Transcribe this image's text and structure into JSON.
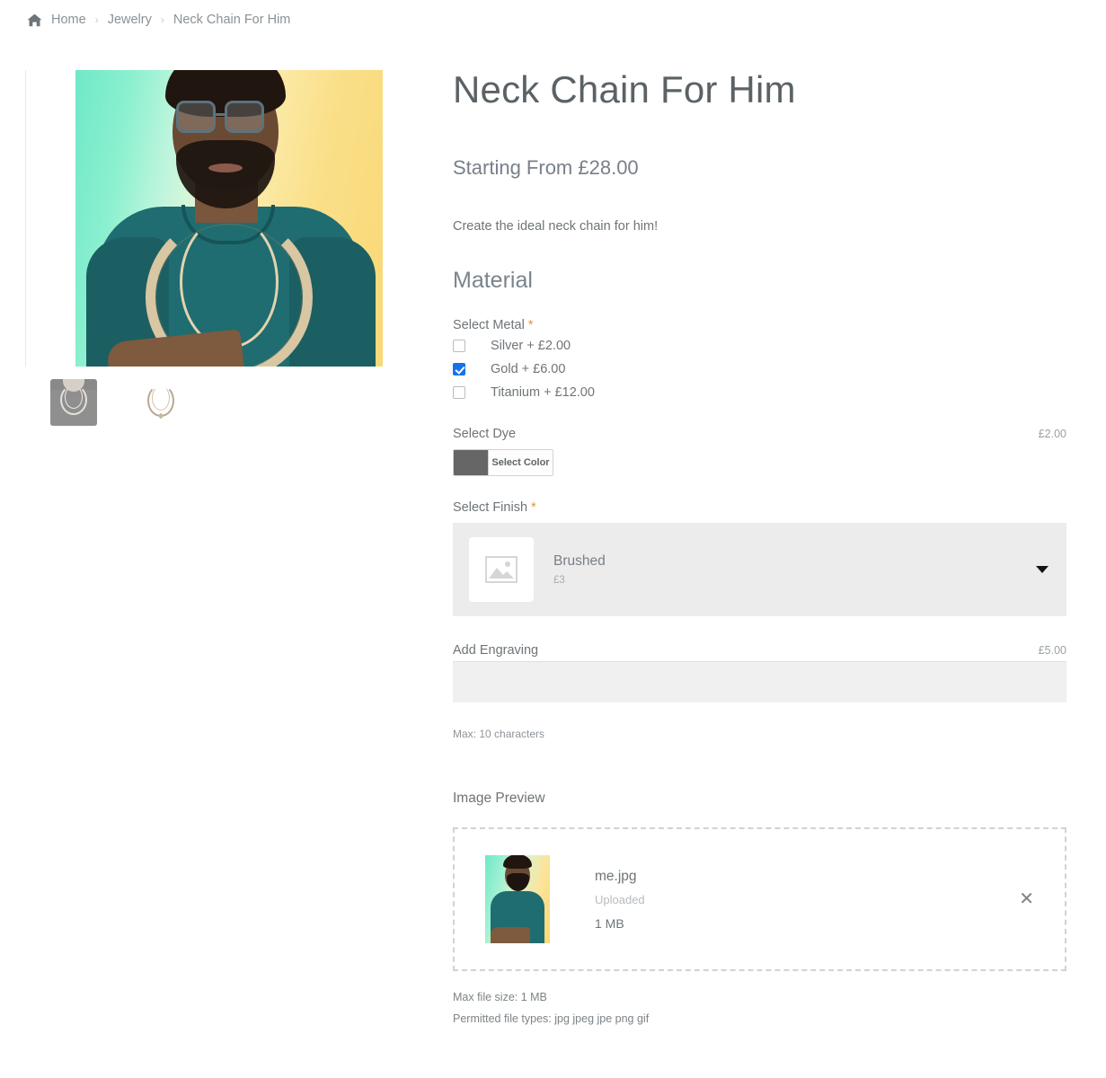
{
  "breadcrumb": {
    "home_icon": "home-icon",
    "items": [
      {
        "label": "Home"
      },
      {
        "label": "Jewelry"
      },
      {
        "label": "Neck Chain For Him"
      }
    ],
    "separator": "›"
  },
  "gallery": {
    "main_image_alt": "Man wearing gold cuban neck chain",
    "thumbnails": [
      {
        "alt": "neck chain on gray mannequin",
        "active": true
      },
      {
        "alt": "neck chain on white background",
        "active": false
      }
    ]
  },
  "product": {
    "title": "Neck Chain For Him",
    "price_label": "Starting From £28.00",
    "description": "Create the ideal neck chain for him!"
  },
  "material": {
    "heading": "Material",
    "metal": {
      "label": "Select Metal",
      "required_marker": "*",
      "options": [
        {
          "label": "Silver + £2.00",
          "checked": false
        },
        {
          "label": "Gold + £6.00",
          "checked": true
        },
        {
          "label": "Titanium + £12.00",
          "checked": false
        }
      ]
    },
    "dye": {
      "label": "Select Dye",
      "price": "£2.00",
      "swatch_color": "#666666",
      "button_label": "Select Color"
    },
    "finish": {
      "label": "Select Finish",
      "required_marker": "*",
      "selected_name": "Brushed",
      "selected_price": "£3",
      "thumb_icon": "image-placeholder-icon",
      "caret_icon": "chevron-down-icon"
    },
    "engraving": {
      "label": "Add Engraving",
      "price": "£5.00",
      "value": "",
      "placeholder": "",
      "helper": "Max: 10 characters"
    }
  },
  "upload": {
    "label": "Image Preview",
    "file": {
      "name": "me.jpg",
      "status": "Uploaded",
      "size": "1 MB",
      "remove_icon": "close-icon",
      "thumb_alt": "uploaded portrait me.jpg"
    },
    "max_size_note": "Max file size: 1 MB",
    "permitted_note": "Permitted file types: jpg jpeg jpe png gif"
  },
  "colors": {
    "accent_blue": "#1474e8",
    "required_orange": "#d99a3a",
    "text_gray": "#6e7478",
    "panel_gray": "#ececec"
  }
}
